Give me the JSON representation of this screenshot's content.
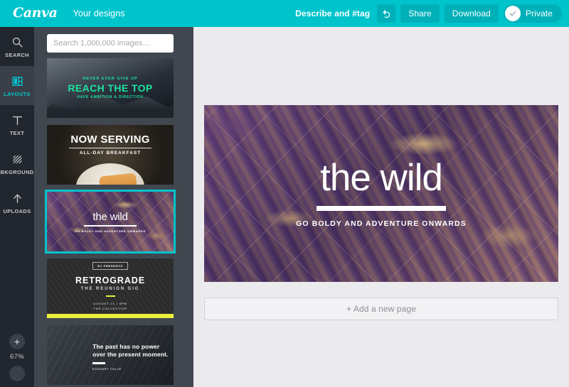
{
  "header": {
    "logo": "Canva",
    "nav_label": "Your designs",
    "describe_tag": "Describe and #tag",
    "undo_icon": "undo-icon",
    "share_label": "Share",
    "download_label": "Download",
    "privacy_label": "Private",
    "privacy_icon": "check-circle-icon",
    "accent_color": "#00c4cc",
    "button_color": "#00b0b9"
  },
  "rail": {
    "items": [
      {
        "label": "SEARCH",
        "icon": "search-icon",
        "active": false
      },
      {
        "label": "LAYOUTS",
        "icon": "layouts-icon",
        "active": true
      },
      {
        "label": "TEXT",
        "icon": "text-icon",
        "active": false
      },
      {
        "label": "BKGROUND",
        "icon": "background-icon",
        "active": false
      },
      {
        "label": "UPLOADS",
        "icon": "upload-icon",
        "active": false
      }
    ],
    "zoom_in_label": "+",
    "zoom_percent": "67%",
    "active_color": "#00c4cc"
  },
  "panel": {
    "search_placeholder": "Search 1,000,000 images…",
    "search_value": "",
    "selected_index": 2,
    "selection_color": "#00c4cc",
    "thumbnails": [
      {
        "name": "reach-the-top",
        "line_top": "NEVER EVER GIVE UP",
        "line_main": "REACH THE TOP",
        "line_bottom": "HAVE AMBITION & DIRECTION",
        "accent": "#1de2a0"
      },
      {
        "name": "now-serving",
        "line_main": "NOW SERVING",
        "line_bottom": "ALL-DAY BREAKFAST"
      },
      {
        "name": "the-wild",
        "line_main": "the wild",
        "line_bottom": "GO BOLDY AND ADVENTURE ONWARDS"
      },
      {
        "name": "retrograde",
        "badge": "RJ PRESENTS",
        "line_main": "RETROGRADE",
        "line_sub": "THE REUNION GIG",
        "line_date": "AUGUST 21 | 8PM",
        "line_venue": "THE COLLECTIVE",
        "accent": "#e9f03a"
      },
      {
        "name": "present-moment-quote",
        "quote": "The past has no power over the present moment.",
        "attribution": "ECKHART TOLLE"
      }
    ]
  },
  "canvas": {
    "title": "the wild",
    "subtitle": "GO BOLDY AND ADVENTURE ONWARDS",
    "background_color": "#5b3d72",
    "add_page_label": "+ Add a new page"
  }
}
